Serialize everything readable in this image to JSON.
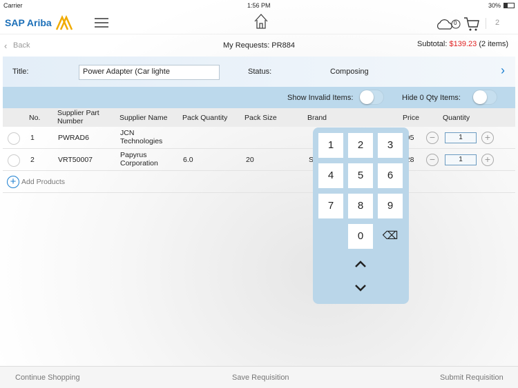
{
  "status_bar": {
    "carrier": "Carrier",
    "time": "1:56 PM",
    "battery": "30%"
  },
  "header": {
    "logo": "SAP Ariba",
    "sync_count": "0",
    "cart_count": "2"
  },
  "subbar": {
    "back": "Back",
    "title": "My Requests: PR884",
    "subtotal_label": "Subtotal:",
    "subtotal": "$139.23",
    "items": "(2 items)"
  },
  "titlebar": {
    "title_label": "Title:",
    "title_value": "Power Adapter (Car lighte",
    "status_label": "Status:",
    "status_value": "Composing"
  },
  "filters": {
    "show_invalid": "Show Invalid Items:",
    "hide_zero": "Hide 0 Qty Items:"
  },
  "columns": [
    "No.",
    "Supplier Part Number",
    "Supplier Name",
    "Pack Quantity",
    "Pack Size",
    "Brand",
    "Price",
    "Quantity"
  ],
  "rows": [
    {
      "no": "1",
      "part": "PWRAD6",
      "supplier": "JCN Technologies",
      "pack_qty": "",
      "pack_size": "",
      "brand": "",
      "price": "9.95",
      "qty": "1"
    },
    {
      "no": "2",
      "part": "VRT50007",
      "supplier": "Papyrus Corporation",
      "pack_qty": "6.0",
      "pack_size": "20",
      "brand": "S",
      "price": "9.28",
      "qty": "1"
    }
  ],
  "add_products": "Add Products",
  "keypad": {
    "keys": [
      "1",
      "2",
      "3",
      "4",
      "5",
      "6",
      "7",
      "8",
      "9",
      "0"
    ],
    "backspace": "⌫",
    "up": "⌃",
    "down": "⌄"
  },
  "footer": {
    "continue": "Continue Shopping",
    "save": "Save Requisition",
    "submit": "Submit Requisition"
  },
  "colors": {
    "brand": "#1b6fb8",
    "subtotal": "#e02020"
  }
}
